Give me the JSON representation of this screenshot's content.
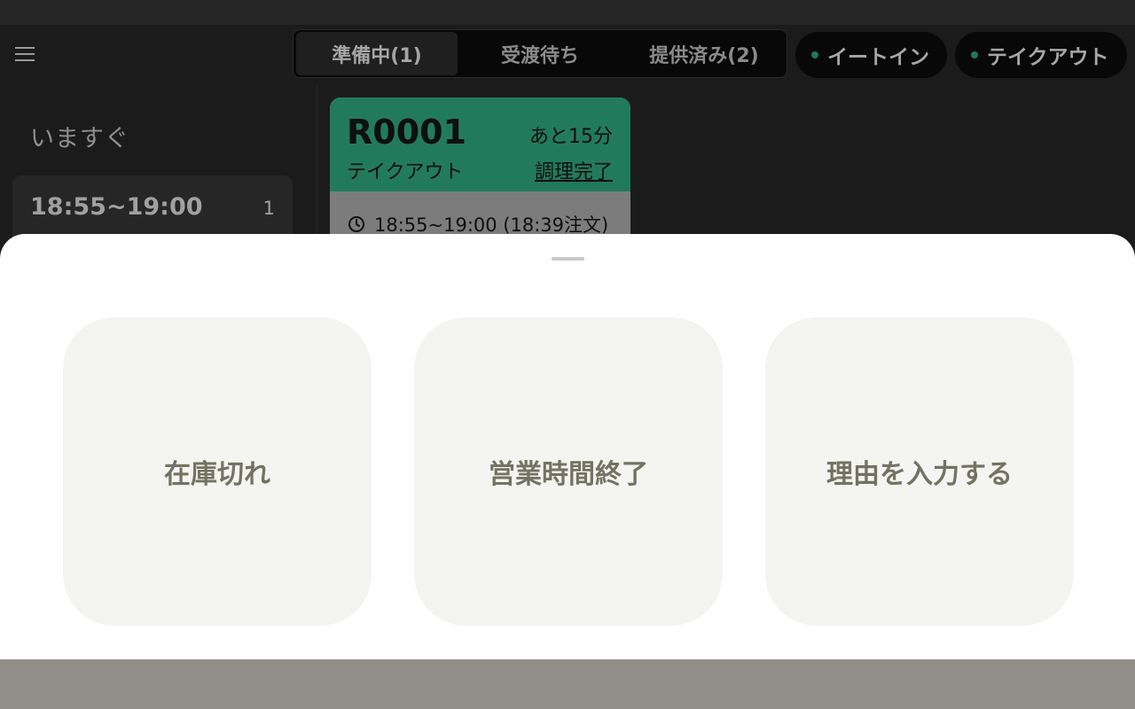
{
  "sidebar": {
    "title": "いますぐ",
    "slots": [
      {
        "time": "18:55~19:00",
        "count": "1"
      }
    ]
  },
  "status_tabs": [
    {
      "label": "準備中(1)",
      "active": true
    },
    {
      "label": "受渡待ち",
      "active": false
    },
    {
      "label": "提供済み(2)",
      "active": false
    }
  ],
  "filters": [
    {
      "label": "イートイン"
    },
    {
      "label": "テイクアウト"
    }
  ],
  "order": {
    "id": "R0001",
    "remaining": "あと15分",
    "type": "テイクアウト",
    "action": "調理完了",
    "pickup": "18:55~19:00 (18:39注文)"
  },
  "sheet": {
    "reasons": [
      {
        "label": "在庫切れ"
      },
      {
        "label": "営業時間終了"
      },
      {
        "label": "理由を入力する"
      }
    ]
  },
  "colors": {
    "accent": "#227a5c",
    "dot": "#1d7a58",
    "reason_bg": "#f4f4f2",
    "reason_text": "#737363"
  },
  "icons": {
    "menu": "hamburger-icon",
    "clock": "clock-icon"
  }
}
